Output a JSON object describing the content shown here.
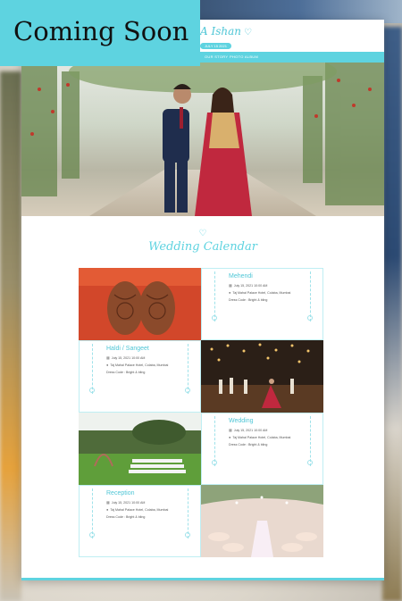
{
  "banner": {
    "text": "Coming Soon",
    "background": "#5ed3e0"
  },
  "site": {
    "brand": "A Ishan",
    "pill": "JULY 15 2021",
    "nav": [
      "OUR STORY",
      "PHOTO ALBUM"
    ]
  },
  "calendar": {
    "title": "Wedding Calendar",
    "events": [
      {
        "name": "Mehendi",
        "date": "July 15, 2021 10:00 AM",
        "venue": "Taj Mahal Palace Hotel, Colaba, Mumbai",
        "dress": "Dress Code : Bright & bling"
      },
      {
        "name": "Haldi / Sangeet",
        "date": "July 15, 2021 10:00 AM",
        "venue": "Taj Mahal Palace Hotel, Colaba, Mumbai",
        "dress": "Dress Code : Bright & bling"
      },
      {
        "name": "Wedding",
        "date": "July 15, 2021 10:00 AM",
        "venue": "Taj Mahal Palace Hotel, Colaba, Mumbai",
        "dress": "Dress Code : Bright & bling"
      },
      {
        "name": "Reception",
        "date": "July 15, 2021 10:00 AM",
        "venue": "Taj Mahal Palace Hotel, Colaba, Mumbai",
        "dress": "Dress Code : Bright & bling"
      }
    ]
  },
  "colors": {
    "accent": "#5ed3e0",
    "text": "#555555"
  }
}
